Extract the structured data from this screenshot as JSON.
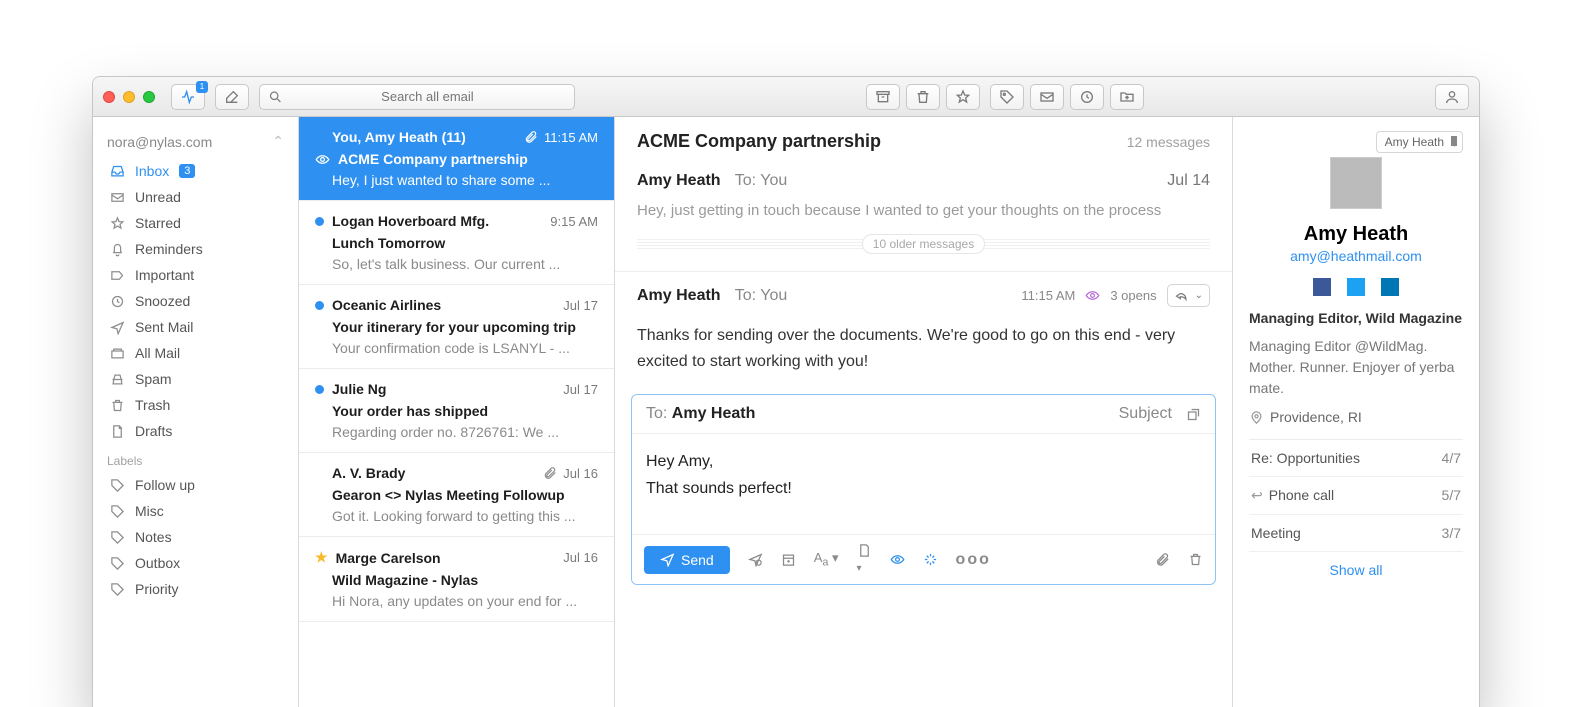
{
  "titlebar": {
    "search_placeholder": "Search all email"
  },
  "account": "nora@nylas.com",
  "sidebar": {
    "items": [
      {
        "label": "Inbox",
        "badge": "3"
      },
      {
        "label": "Unread"
      },
      {
        "label": "Starred"
      },
      {
        "label": "Reminders"
      },
      {
        "label": "Important"
      },
      {
        "label": "Snoozed"
      },
      {
        "label": "Sent Mail"
      },
      {
        "label": "All Mail"
      },
      {
        "label": "Spam"
      },
      {
        "label": "Trash"
      },
      {
        "label": "Drafts"
      }
    ],
    "labels_header": "Labels",
    "labels": [
      {
        "label": "Follow up"
      },
      {
        "label": "Misc"
      },
      {
        "label": "Notes"
      },
      {
        "label": "Outbox"
      },
      {
        "label": "Priority"
      }
    ]
  },
  "threads": [
    {
      "sender": "You, Amy Heath (11)",
      "time": "11:15 AM",
      "subject": "ACME Company partnership",
      "preview": "Hey, I just wanted to share some ...",
      "active": true,
      "attach": true,
      "eye": true
    },
    {
      "sender": "Logan Hoverboard Mfg.",
      "time": "9:15 AM",
      "subject": "Lunch Tomorrow",
      "preview": "So, let's talk business. Our current ...",
      "unread": true
    },
    {
      "sender": "Oceanic Airlines",
      "time": "Jul 17",
      "subject": "Your itinerary for your upcoming trip",
      "preview": "Your confirmation code is LSANYL - ...",
      "unread": true
    },
    {
      "sender": "Julie Ng",
      "time": "Jul 17",
      "subject": "Your order has shipped",
      "preview": "Regarding order no. 8726761: We ...",
      "unread": true
    },
    {
      "sender": "A. V. Brady",
      "time": "Jul 16",
      "subject": "Gearon <> Nylas Meeting Followup",
      "preview": "Got it. Looking forward to getting this ...",
      "attach": true
    },
    {
      "sender": "Marge Carelson",
      "time": "Jul 16",
      "subject": "Wild Magazine - Nylas",
      "preview": "Hi Nora, any updates on your end for ...",
      "star": true
    }
  ],
  "reader": {
    "subject": "ACME Company partnership",
    "count": "12 messages",
    "collapsed": {
      "from": "Amy Heath",
      "to_label": "To:",
      "to": "You",
      "date": "Jul 14",
      "body": "Hey, just getting in touch because I wanted to get your thoughts on the process"
    },
    "older": "10 older messages",
    "open": {
      "from": "Amy Heath",
      "to_label": "To:",
      "to": "You",
      "time": "11:15 AM",
      "opens": "3 opens",
      "body": "Thanks for sending over the documents. We're good to go on this end - very excited to start working with you!"
    },
    "compose": {
      "to_label": "To:",
      "to": "Amy Heath",
      "subject_hint": "Subject",
      "body": "Hey Amy,\nThat sounds perfect!",
      "send": "Send"
    }
  },
  "profile": {
    "picker": "Amy Heath",
    "name": "Amy Heath",
    "email": "amy@heathmail.com",
    "title": "Managing Editor, Wild Magazine",
    "bio": "Managing Editor @WildMag. Mother. Runner. Enjoyer of yerba mate.",
    "location": "Providence, RI",
    "related": [
      {
        "label": "Re: Opportunities",
        "count": "4/7"
      },
      {
        "label": "Phone call",
        "count": "5/7",
        "reply": true
      },
      {
        "label": "Meeting",
        "count": "3/7"
      }
    ],
    "show_all": "Show all"
  }
}
